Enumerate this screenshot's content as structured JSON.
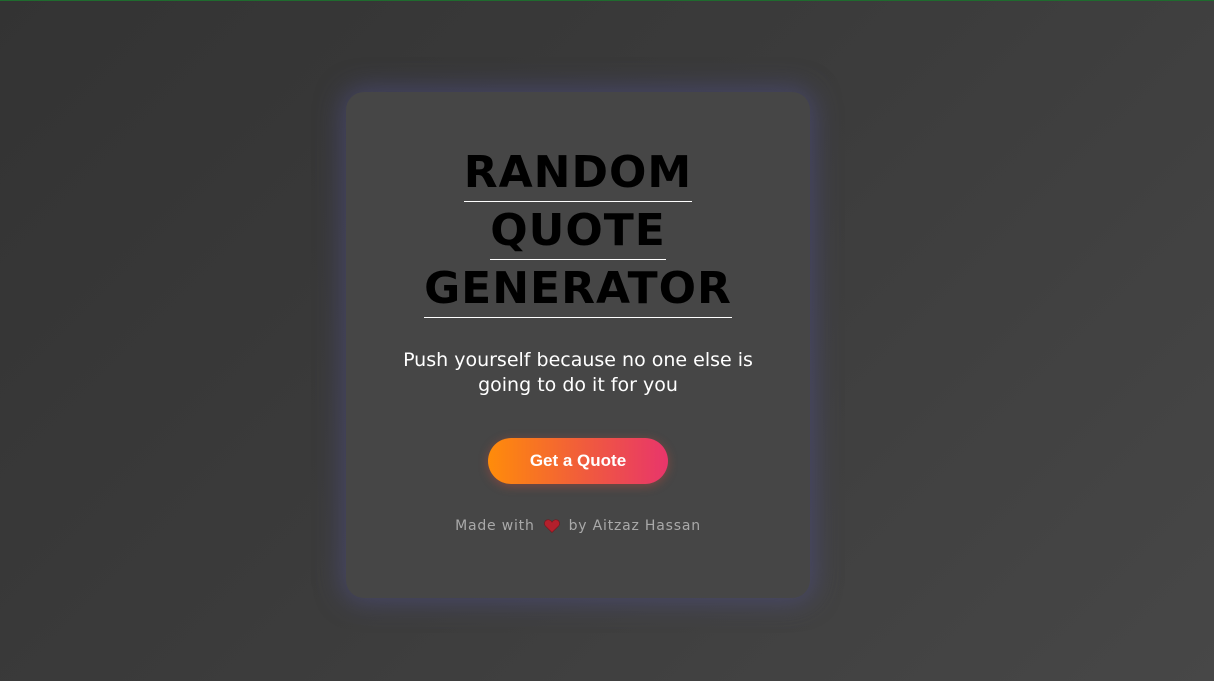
{
  "card": {
    "title_lines": [
      "RANDOM",
      "QUOTE",
      "GENERATOR"
    ],
    "quote_text": "Push yourself because no one else is going to do it for you",
    "button_label": "Get a Quote",
    "footer": {
      "prefix": "Made with",
      "icon": "heart-icon",
      "suffix": "by Aitzaz Hassan"
    }
  },
  "colors": {
    "background": "#3b3b3b",
    "card": "#464646",
    "button_gradient_start": "#ff8c0a",
    "button_gradient_end": "#e8356b",
    "heart": "#b3202c"
  }
}
